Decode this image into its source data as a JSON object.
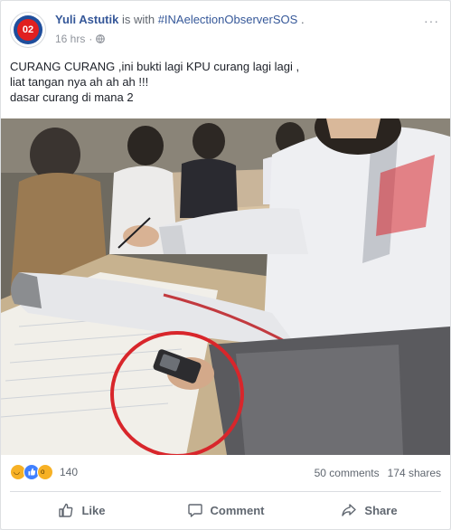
{
  "post": {
    "author": "Yuli Astutik",
    "with_text": "is with",
    "tagged": "#INAelectionObserverSOS",
    "tagged_suffix": ".",
    "time": "16 hrs",
    "time_sep": "·",
    "avatar_text": "02",
    "more_label": "···",
    "text_lines": [
      "CURANG CURANG ,ini bukti lagi KPU curang lagi lagi ,",
      "liat tangan nya ah ah ah !!!",
      "dasar curang di mana 2"
    ]
  },
  "stats": {
    "reaction_count": "140",
    "comments": "50 comments",
    "shares": "174 shares"
  },
  "actions": {
    "like": "Like",
    "comment": "Comment",
    "share": "Share"
  },
  "colors": {
    "link": "#365899",
    "highlight_circle": "#d8262b"
  }
}
